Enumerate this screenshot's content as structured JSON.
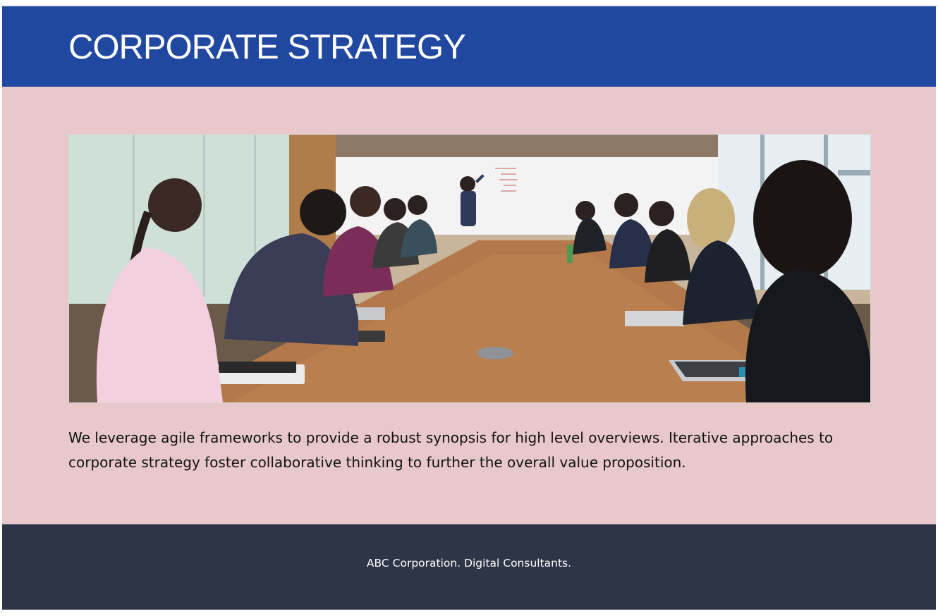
{
  "header": {
    "title": "CORPORATE STRATEGY"
  },
  "main": {
    "image": {
      "alt": "Team meeting around a conference table with a presenter at a whiteboard",
      "icon": "meeting-photo"
    },
    "intro_text": "We leverage agile frameworks to provide a robust synopsis for high level overviews. Iterative approaches to corporate strategy foster collaborative thinking to further the overall value proposition."
  },
  "footer": {
    "text": "ABC Corporation. Digital Consultants."
  },
  "colors": {
    "header_bg": "#2148a0",
    "body_bg": "#e8c8cb",
    "footer_bg": "#2d3546",
    "title_text": "#ffffff",
    "body_text": "#111111",
    "footer_text": "#ffffff"
  }
}
